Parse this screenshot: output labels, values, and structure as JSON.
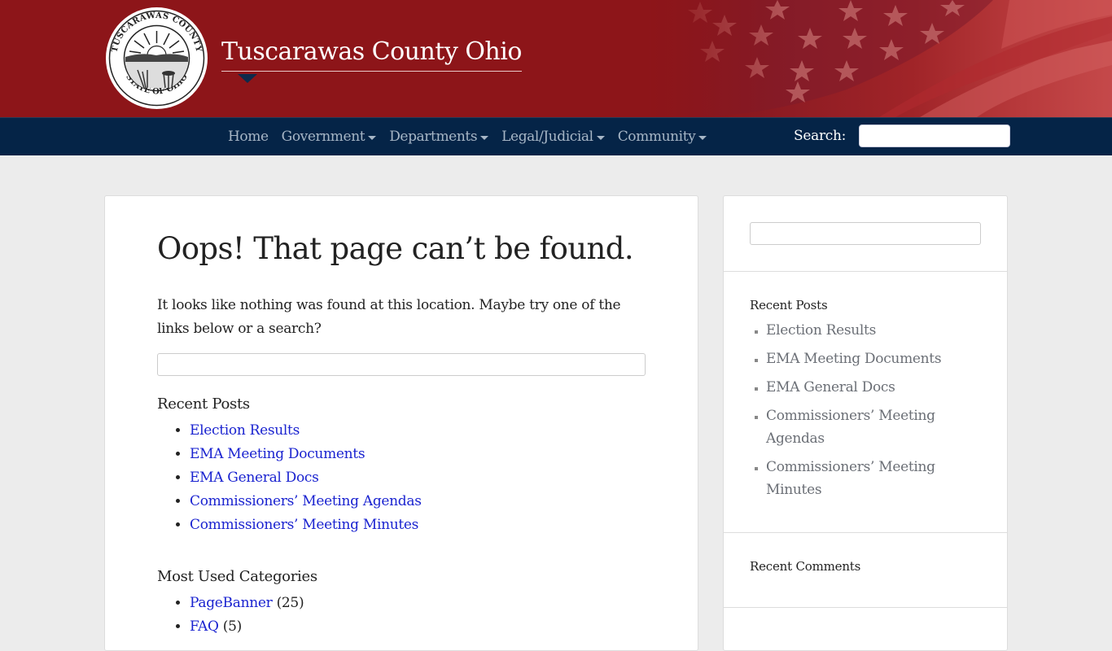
{
  "header": {
    "site_title": "Tuscarawas County Ohio",
    "seal_top_text": "TUSCARAWAS COUNTY",
    "seal_bottom_text": "STATE OF OHIO",
    "brand_color": "#8d1519",
    "nav_color": "#052447"
  },
  "nav": {
    "items": [
      {
        "label": "Home",
        "dropdown": false
      },
      {
        "label": "Government",
        "dropdown": true
      },
      {
        "label": "Departments",
        "dropdown": true
      },
      {
        "label": "Legal/Judicial",
        "dropdown": true
      },
      {
        "label": "Community",
        "dropdown": true
      }
    ],
    "search_label": "Search:",
    "search_value": ""
  },
  "main": {
    "title": "Oops! That page can’t be found.",
    "lead": "It looks like nothing was found at this location. Maybe try one of the links below or a search?",
    "search_value": "",
    "recent_posts_title": "Recent Posts",
    "recent_posts": [
      "Election Results",
      "EMA Meeting Documents",
      "EMA General Docs",
      "Commissioners’ Meeting Agendas",
      "Commissioners’ Meeting Minutes"
    ],
    "categories_title": "Most Used Categories",
    "categories": [
      {
        "name": "PageBanner",
        "count": "(25)"
      },
      {
        "name": "FAQ",
        "count": "(5)"
      }
    ]
  },
  "sidebar": {
    "search_value": "",
    "recent_posts_title": "Recent Posts",
    "recent_posts": [
      "Election Results",
      "EMA Meeting Documents",
      "EMA General Docs",
      "Commissioners’ Meeting Agendas",
      "Commissioners’ Meeting Minutes"
    ],
    "recent_comments_title": "Recent Comments"
  }
}
